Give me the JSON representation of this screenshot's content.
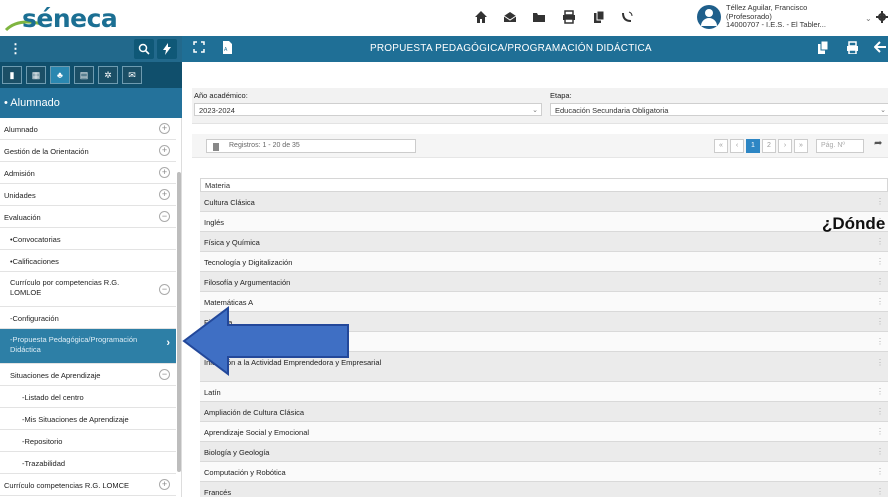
{
  "header": {
    "logo": "séneca",
    "user_name": "Téllez Aguilar, Francisco",
    "user_role": "(Profesorado)",
    "user_center": "14000707 - I.E.S. - El Tabler...",
    "icons": [
      "home-icon",
      "messages-icon",
      "folder-icon",
      "print-icon",
      "copy-icon",
      "phone-icon",
      "user-icon",
      "settings-icon"
    ]
  },
  "bar": {
    "menu_glyph": "⋮",
    "title": "PROPUESTA PEDAGÓGICA/PROGRAMACIÓN DIDÁCTICA"
  },
  "sidebar": {
    "section_title": "• Alumnado",
    "items": [
      {
        "label": "Alumnado",
        "type": "top",
        "toggle": "+"
      },
      {
        "label": "Gestión de la Orientación",
        "type": "top",
        "toggle": "+"
      },
      {
        "label": "Admisión",
        "type": "top",
        "toggle": "+"
      },
      {
        "label": "Unidades",
        "type": "top",
        "toggle": "+"
      },
      {
        "label": "Evaluación",
        "type": "top",
        "toggle": "−"
      },
      {
        "label": "•Convocatorias",
        "type": "sub"
      },
      {
        "label": "•Calificaciones",
        "type": "sub"
      },
      {
        "label": "Currículo por competencias R.G. LOMLOE",
        "type": "sub tall",
        "toggle": "−"
      },
      {
        "label": "-Configuración",
        "type": "sub"
      },
      {
        "label": "-Propuesta Pedagógica/Programación Didáctica",
        "type": "sub tall active",
        "chev": "›"
      },
      {
        "label": "Situaciones de Aprendizaje",
        "type": "sub",
        "toggle": "−"
      },
      {
        "label": "-Listado del centro",
        "type": "subsub"
      },
      {
        "label": "-Mis Situaciones de Aprendizaje",
        "type": "subsub"
      },
      {
        "label": "-Repositorio",
        "type": "subsub"
      },
      {
        "label": "-Trazabilidad",
        "type": "subsub"
      },
      {
        "label": "Currículo competencias R.G. LOMCE",
        "type": "top",
        "toggle": "+"
      }
    ]
  },
  "filters": {
    "year_label": "Año académico:",
    "year_value": "2023-2024",
    "stage_label": "Etapa:",
    "stage_value": "Educación Secundaria Obligatoria"
  },
  "records": {
    "label": "Registros: 1 - 20 de 35",
    "pages": [
      "«",
      "‹",
      "1",
      "2",
      "›",
      "»"
    ],
    "current_page": "1",
    "page_placeholder": "Pág. Nº"
  },
  "table": {
    "header": "Materia",
    "rows": [
      "Cultura Clásica",
      "Inglés",
      "Física y Química",
      "Tecnología y Digitalización",
      "Filosofía y Argumentación",
      "Matemáticas A",
      "Filosofía",
      "",
      "Iniciación a la Actividad Emprendedora y Empresarial",
      "Latín",
      "Ampliación de Cultura Clásica",
      "Aprendizaje Social y Emocional",
      "Biología y Geología",
      "Computación y Robótica",
      "Francés"
    ],
    "row_menu": "⋮"
  },
  "overlay": {
    "text": "¿Dónde"
  },
  "colors": {
    "header_bar": "#1f6f96",
    "active_item": "#2d7fa6",
    "arrow_fill": "#3f6fc4",
    "arrow_stroke": "#23489a"
  }
}
